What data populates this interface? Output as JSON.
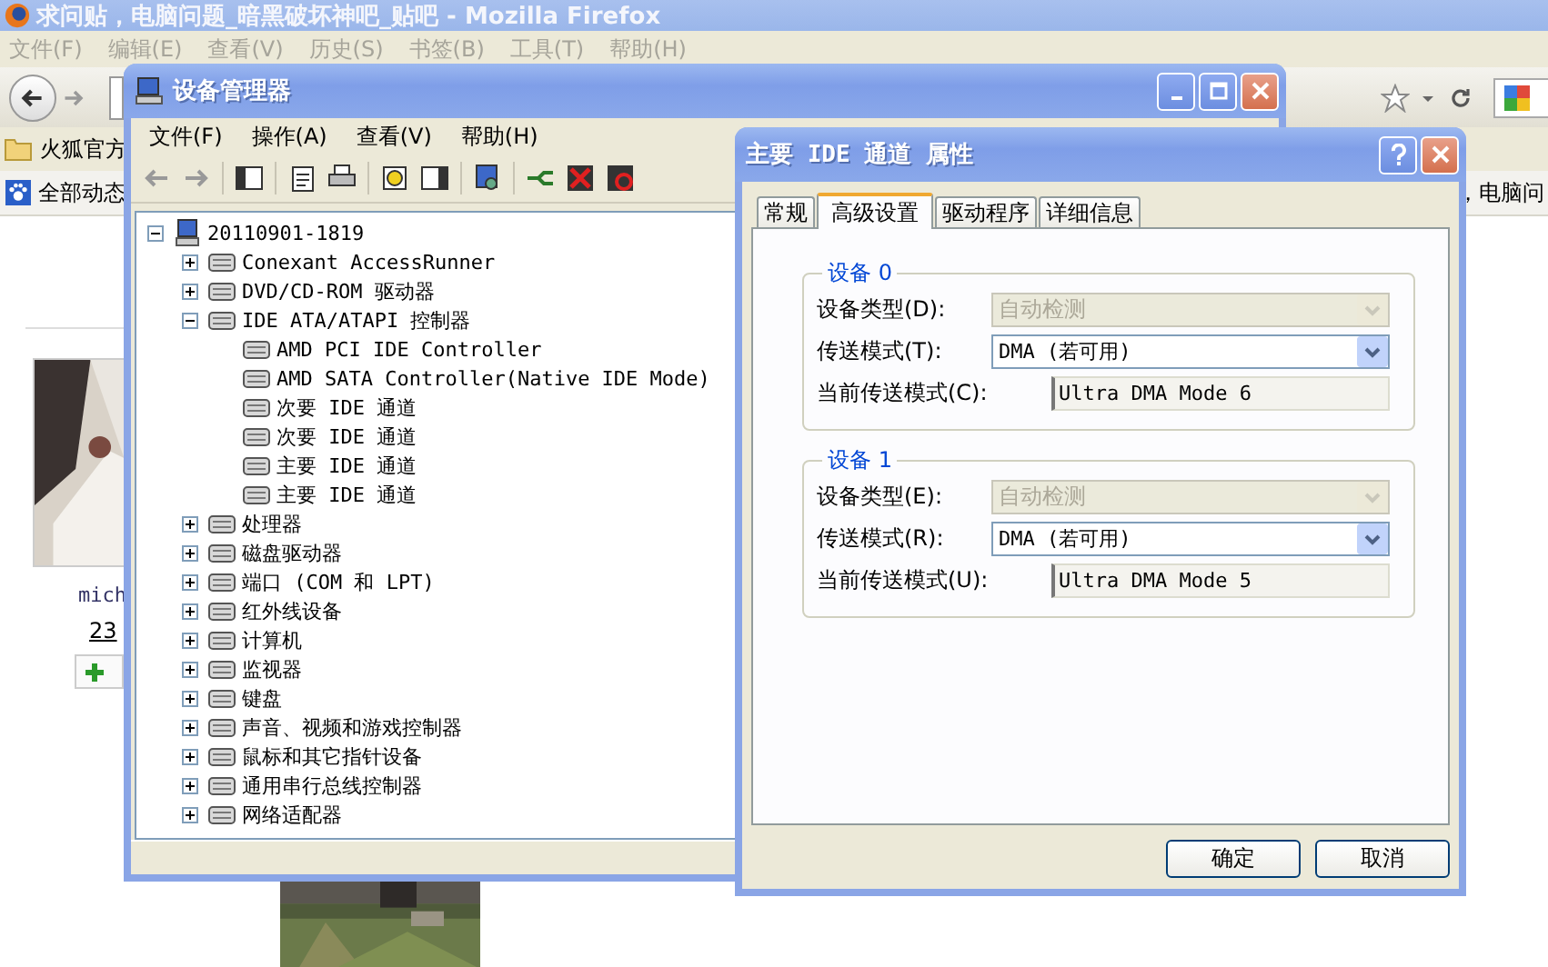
{
  "browser": {
    "title": "求问贴，电脑问题_暗黑破坏神吧_贴吧 - Mozilla Firefox",
    "menu": [
      "文件(F)",
      "编辑(E)",
      "查看(V)",
      "历史(S)",
      "书签(B)",
      "工具(T)",
      "帮助(H)"
    ],
    "bookmark": "火狐官方",
    "feed_link": "全部动态",
    "page_snippet": "，电脑问",
    "profile": {
      "name": "mich",
      "count": "23"
    }
  },
  "device_manager": {
    "title": "设备管理器",
    "menu": [
      "文件(F)",
      "操作(A)",
      "查看(V)",
      "帮助(H)"
    ],
    "tree": {
      "label": "20110901-1819",
      "expanded": true,
      "children": [
        {
          "label": "Conexant AccessRunner",
          "expanded": false
        },
        {
          "label": "DVD/CD-ROM 驱动器",
          "expanded": false
        },
        {
          "label": "IDE ATA/ATAPI 控制器",
          "expanded": true,
          "children": [
            {
              "label": "AMD PCI IDE Controller"
            },
            {
              "label": "AMD SATA Controller(Native IDE Mode)"
            },
            {
              "label": "次要 IDE 通道"
            },
            {
              "label": "次要 IDE 通道"
            },
            {
              "label": "主要 IDE 通道"
            },
            {
              "label": "主要 IDE 通道"
            }
          ]
        },
        {
          "label": "处理器",
          "expanded": false
        },
        {
          "label": "磁盘驱动器",
          "expanded": false
        },
        {
          "label": "端口 (COM 和 LPT)",
          "expanded": false
        },
        {
          "label": "红外线设备",
          "expanded": false
        },
        {
          "label": "计算机",
          "expanded": false
        },
        {
          "label": "监视器",
          "expanded": false
        },
        {
          "label": "键盘",
          "expanded": false
        },
        {
          "label": "声音、视频和游戏控制器",
          "expanded": false
        },
        {
          "label": "鼠标和其它指针设备",
          "expanded": false
        },
        {
          "label": "通用串行总线控制器",
          "expanded": false
        },
        {
          "label": "网络适配器",
          "expanded": false
        }
      ]
    }
  },
  "dialog": {
    "title": "主要 IDE 通道 属性",
    "tabs": [
      {
        "label": "常规",
        "selected": false
      },
      {
        "label": "高级设置",
        "selected": true
      },
      {
        "label": "驱动程序",
        "selected": false
      },
      {
        "label": "详细信息",
        "selected": false
      }
    ],
    "groups": [
      {
        "title": "设备 0",
        "rows": [
          {
            "kind": "combo",
            "label": "设备类型(D):",
            "value": "自动检测",
            "disabled": true
          },
          {
            "kind": "combo",
            "label": "传送模式(T):",
            "value": "DMA (若可用)",
            "disabled": false
          },
          {
            "kind": "readonly",
            "label": "当前传送模式(C):",
            "value": "Ultra DMA Mode 6"
          }
        ]
      },
      {
        "title": "设备 1",
        "rows": [
          {
            "kind": "combo",
            "label": "设备类型(E):",
            "value": "自动检测",
            "disabled": true
          },
          {
            "kind": "combo",
            "label": "传送模式(R):",
            "value": "DMA (若可用)",
            "disabled": false
          },
          {
            "kind": "readonly",
            "label": "当前传送模式(U):",
            "value": "Ultra DMA Mode 5"
          }
        ]
      }
    ],
    "buttons": [
      "确定",
      "取消"
    ]
  }
}
